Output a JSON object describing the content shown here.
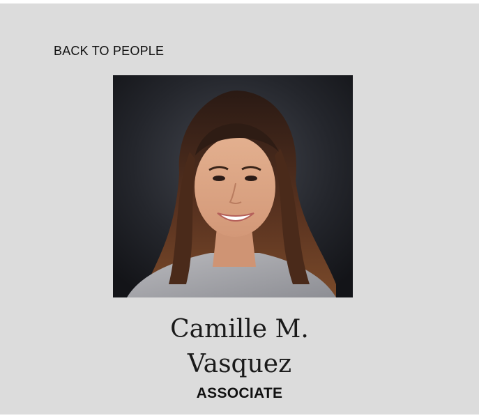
{
  "nav": {
    "back_label": "BACK TO PEOPLE"
  },
  "profile": {
    "name_line1": "Camille M.",
    "name_line2": "Vasquez",
    "role": "ASSOCIATE",
    "photo_icon": "portrait-photo"
  },
  "colors": {
    "panel_bg": "#dcdcdc",
    "text": "#111111"
  }
}
